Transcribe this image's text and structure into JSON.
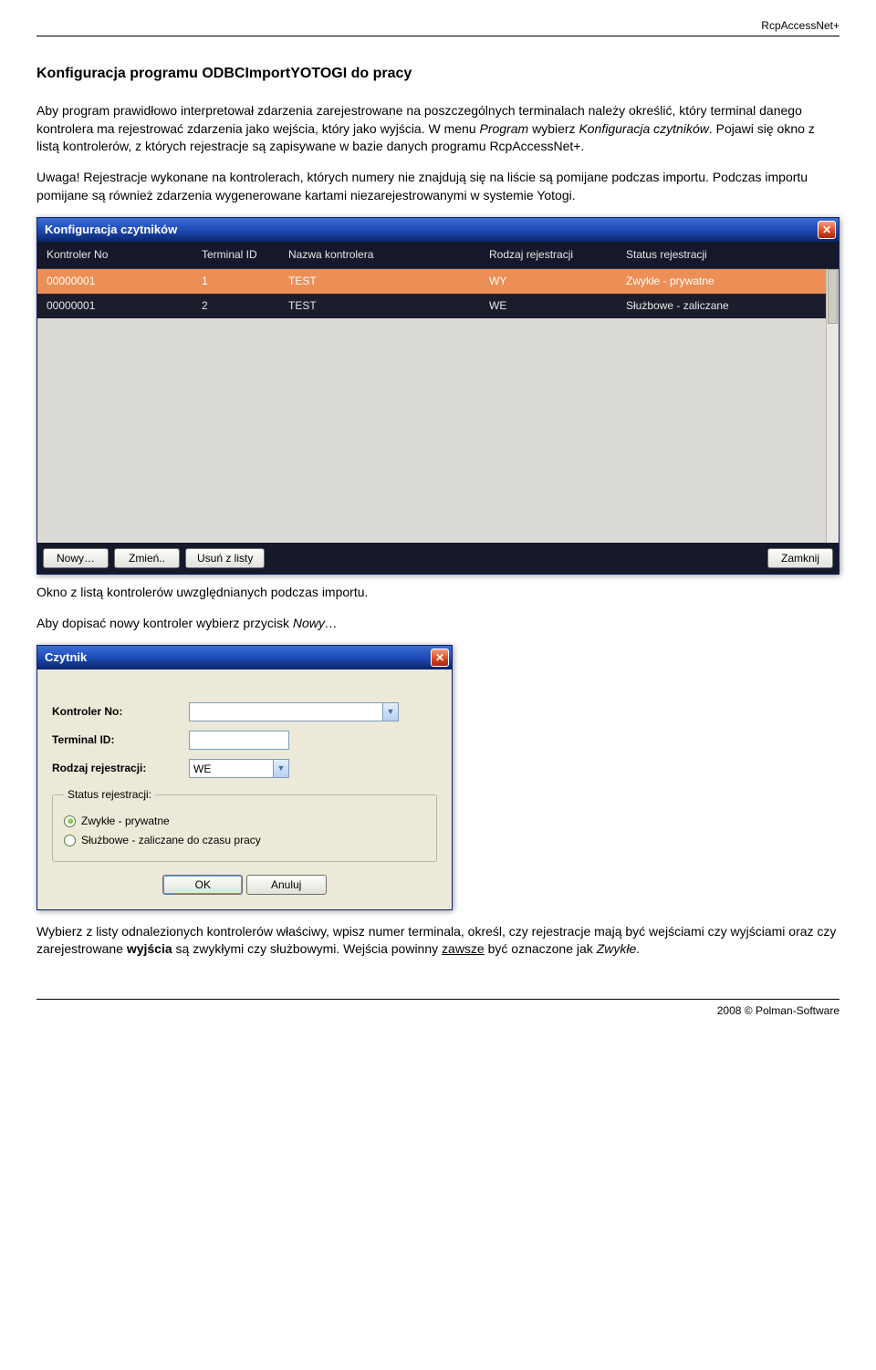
{
  "header": {
    "product": "RcpAccessNet+"
  },
  "section": {
    "title": "Konfiguracja programu ODBCImportYOTOGI do pracy",
    "p1a": "Aby program prawidłowo interpretował zdarzenia zarejestrowane na poszczególnych terminalach należy określić, który terminal danego kontrolera ma rejestrować zdarzenia jako wejścia, który jako wyjścia. W menu ",
    "p1b_i": "Program",
    "p1c": " wybierz ",
    "p1d_i": "Konfiguracja czytników",
    "p1e": ". Pojawi się okno z listą kontrolerów, z których rejestracje są zapisywane w bazie danych programu RcpAccessNet+.",
    "p2": "Uwaga! Rejestracje wykonane na kontrolerach, których numery nie znajdują się na liście są pomijane podczas importu. Podczas importu pomijane są również zdarzenia wygenerowane kartami niezarejestrowanymi w systemie Yotogi.",
    "caption1": "Okno z listą kontrolerów uwzględnianych podczas importu.",
    "p3a": "Aby dopisać nowy kontroler wybierz przycisk ",
    "p3b_i": "Nowy…",
    "p4a": "Wybierz z listy odnalezionych kontrolerów właściwy, wpisz numer terminala, określ, czy rejestracje mają być wejściami czy wyjściami oraz czy zarejestrowane ",
    "p4b_bold": "wyjścia",
    "p4c": " są zwykłymi czy służbowymi. Wejścia powinny ",
    "p4d_u": "zawsze",
    "p4e": " być oznaczone jak ",
    "p4f_i": "Zwykłe",
    "p4g": "."
  },
  "win1": {
    "title": "Konfiguracja czytników",
    "headers": {
      "kn": "Kontroler No",
      "tid": "Terminal ID",
      "nk": "Nazwa kontrolera",
      "rr": "Rodzaj rejestracji",
      "sr": "Status rejestracji"
    },
    "rows": [
      {
        "kn": "00000001",
        "tid": "1",
        "nk": "TEST",
        "rr": "WY",
        "sr": "Zwykłe - prywatne"
      },
      {
        "kn": "00000001",
        "tid": "2",
        "nk": "TEST",
        "rr": "WE",
        "sr": "Służbowe - zaliczane"
      }
    ],
    "buttons": {
      "new": "Nowy…",
      "edit": "Zmień..",
      "del": "Usuń z listy",
      "close": "Zamknij"
    }
  },
  "win2": {
    "title": "Czytnik",
    "labels": {
      "kn": "Kontroler No:",
      "tid": "Terminal ID:",
      "rr": "Rodzaj rejestracji:"
    },
    "values": {
      "kn": "",
      "tid": "",
      "rr": "WE"
    },
    "fieldset": {
      "legend": "Status rejestracji:",
      "opt1": "Zwykłe - prywatne",
      "opt2": "Służbowe - zaliczane do czasu pracy"
    },
    "buttons": {
      "ok": "OK",
      "cancel": "Anuluj"
    }
  },
  "footer": {
    "copyright": "2008 © Polman-Software"
  }
}
